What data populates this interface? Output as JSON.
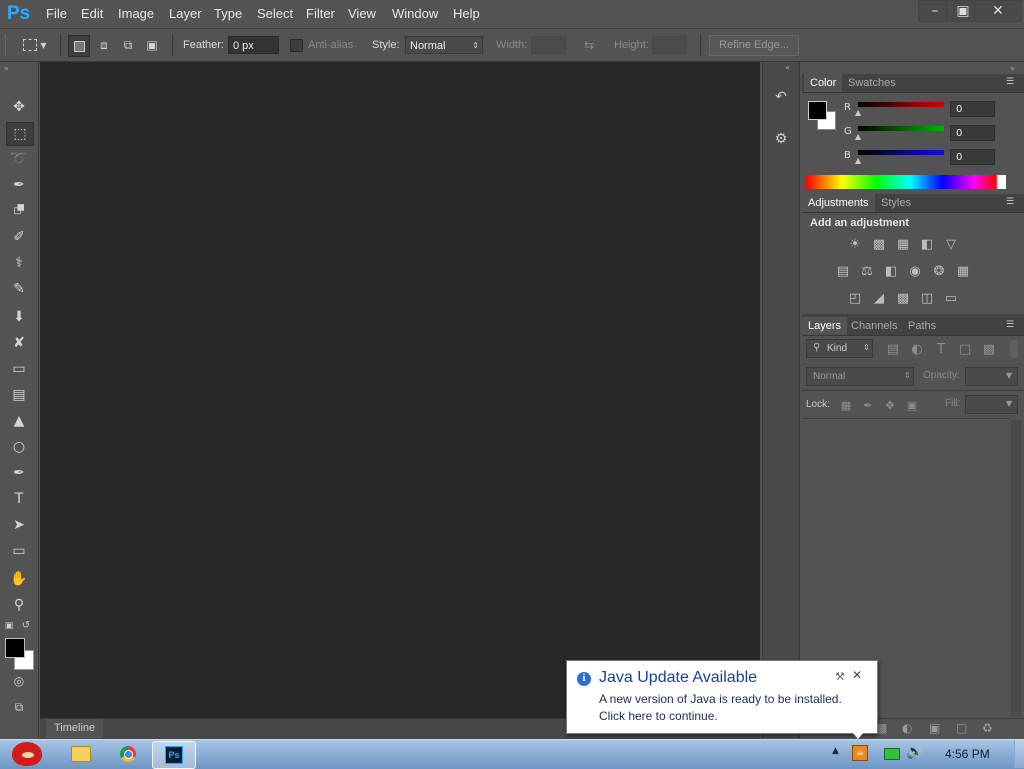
{
  "app": {
    "logo": "Ps"
  },
  "menu": [
    "File",
    "Edit",
    "Image",
    "Layer",
    "Type",
    "Select",
    "Filter",
    "View",
    "Window",
    "Help"
  ],
  "window_controls": {
    "minimize": "–",
    "restore": "▣",
    "close": "✕"
  },
  "options": {
    "feather_label": "Feather:",
    "feather_value": "0 px",
    "antialias_label": "Anti-alias",
    "style_label": "Style:",
    "style_value": "Normal",
    "width_label": "Width:",
    "height_label": "Height:",
    "refine_edge": "Refine Edge..."
  },
  "tools": [
    "move-tool",
    "rectangular-marquee-tool",
    "lasso-tool",
    "quick-selection-tool",
    "crop-tool",
    "eyedropper-tool",
    "spot-healing-brush-tool",
    "brush-tool",
    "clone-stamp-tool",
    "history-brush-tool",
    "eraser-tool",
    "gradient-tool",
    "blur-tool",
    "dodge-tool",
    "pen-tool",
    "type-tool",
    "path-selection-tool",
    "rectangle-tool",
    "hand-tool",
    "zoom-tool"
  ],
  "tool_glyphs": [
    "✥",
    "⬚",
    "➰",
    "✒",
    "⮻",
    "✐",
    "⚕",
    "✎",
    "⬇",
    "✘",
    "▭",
    "▤",
    "▲",
    "○",
    "✒",
    "T",
    "➤",
    "▭",
    "✋",
    "⚲"
  ],
  "timeline": {
    "label": "Timeline"
  },
  "color_panel": {
    "tabs": [
      "Color",
      "Swatches"
    ],
    "channels": [
      {
        "label": "R",
        "value": "0",
        "color": "#d40000"
      },
      {
        "label": "G",
        "value": "0",
        "color": "#00b400"
      },
      {
        "label": "B",
        "value": "0",
        "color": "#1010e0"
      }
    ],
    "foreground": "#000000",
    "background": "#ffffff"
  },
  "adjustments_panel": {
    "tabs": [
      "Adjustments",
      "Styles"
    ],
    "heading": "Add an adjustment",
    "icons_row1": [
      "brightness-contrast-icon",
      "levels-icon",
      "curves-icon",
      "exposure-icon",
      "vibrance-icon"
    ],
    "icons_row2": [
      "hue-saturation-icon",
      "color-balance-icon",
      "black-white-icon",
      "photo-filter-icon",
      "channel-mixer-icon",
      "color-lookup-icon"
    ],
    "icons_row3": [
      "invert-icon",
      "posterize-icon",
      "threshold-icon",
      "selective-color-icon",
      "gradient-map-icon"
    ]
  },
  "layers_panel": {
    "tabs": [
      "Layers",
      "Channels",
      "Paths"
    ],
    "kind_label": "Kind",
    "blend_mode": "Normal",
    "opacity_label": "Opacity:",
    "lock_label": "Lock:",
    "fill_label": "Fill:"
  },
  "balloon": {
    "title": "Java Update Available",
    "line1": "A new version of Java is ready to be installed.",
    "line2": "Click here to continue."
  },
  "taskbar": {
    "clock": "4:56 PM",
    "apps": [
      "angry-birds-icon",
      "explorer-icon",
      "chrome-icon",
      "photoshop-icon"
    ],
    "ps_label": "Ps"
  },
  "colors": {
    "accent": "#31a8ff",
    "canvas": "#282828",
    "panel": "#535353"
  }
}
